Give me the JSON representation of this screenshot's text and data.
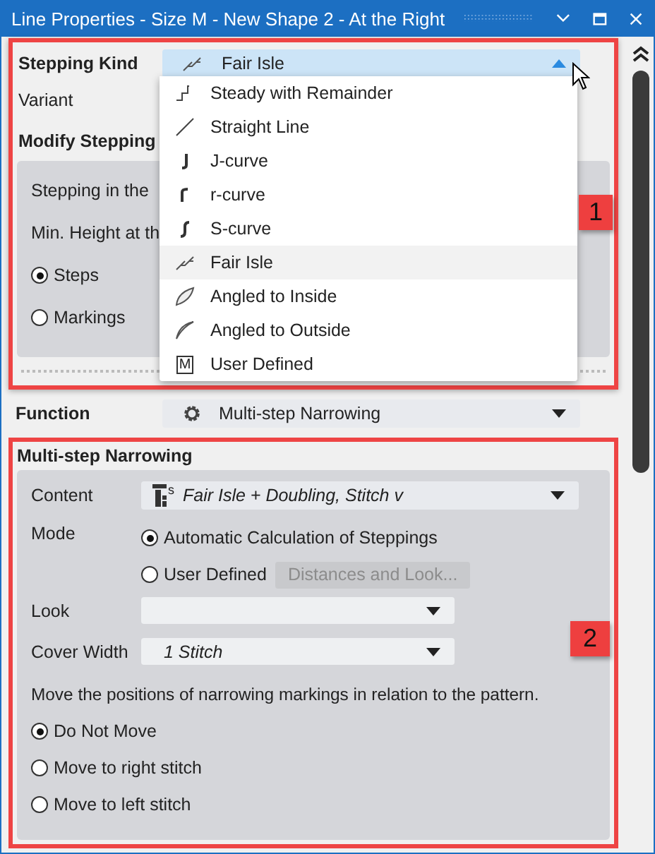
{
  "window": {
    "title": "Line Properties - Size M - New Shape 2 - At the Right"
  },
  "section_1": {
    "badge": "1",
    "stepping_kind": {
      "label": "Stepping Kind",
      "value": "Fair Isle",
      "kind": "fairisle",
      "expanded": true
    },
    "variant": {
      "label": "Variant"
    },
    "modify_stepping": {
      "title": "Modify Stepping",
      "stepping_label": "Stepping in the",
      "min_height_label": "Min. Height at th",
      "radios": [
        {
          "label": "Steps",
          "selected": true
        },
        {
          "label": "Markings",
          "selected": false
        }
      ]
    },
    "dropdown": [
      {
        "label": "Steady with Remainder",
        "kind": "steady",
        "selected": false
      },
      {
        "label": "Straight Line",
        "kind": "straight",
        "selected": false
      },
      {
        "label": "J-curve",
        "kind": "jcurve",
        "selected": false
      },
      {
        "label": "r-curve",
        "kind": "rcurve",
        "selected": false
      },
      {
        "label": "S-curve",
        "kind": "scurve",
        "selected": false
      },
      {
        "label": "Fair Isle",
        "kind": "fairisle",
        "selected": true
      },
      {
        "label": "Angled to Inside",
        "kind": "inside",
        "selected": false
      },
      {
        "label": "Angled to Outside",
        "kind": "outside",
        "selected": false
      },
      {
        "label": "User Defined",
        "kind": "user",
        "icon_text": "M",
        "selected": false
      }
    ]
  },
  "function": {
    "label": "Function",
    "value": "Multi-step Narrowing"
  },
  "section_2": {
    "badge": "2",
    "title": "Multi-step Narrowing",
    "content": {
      "label": "Content",
      "value": "Fair Isle + Doubling, Stitch v",
      "icon_text": "s"
    },
    "mode": {
      "label": "Mode",
      "options": [
        {
          "label": "Automatic Calculation of Steppings",
          "selected": true
        },
        {
          "label": "User Defined",
          "selected": false
        }
      ],
      "button": {
        "label": "Distances and Look...",
        "disabled": true
      }
    },
    "look": {
      "label": "Look"
    },
    "cover_width": {
      "label": "Cover Width",
      "value": "1 Stitch"
    },
    "move_text": "Move the positions of narrowing markings in relation to the pattern.",
    "move_options": [
      {
        "label": "Do Not Move",
        "selected": true
      },
      {
        "label": "Move to right stitch",
        "selected": false
      },
      {
        "label": "Move to left stitch",
        "selected": false
      }
    ]
  }
}
